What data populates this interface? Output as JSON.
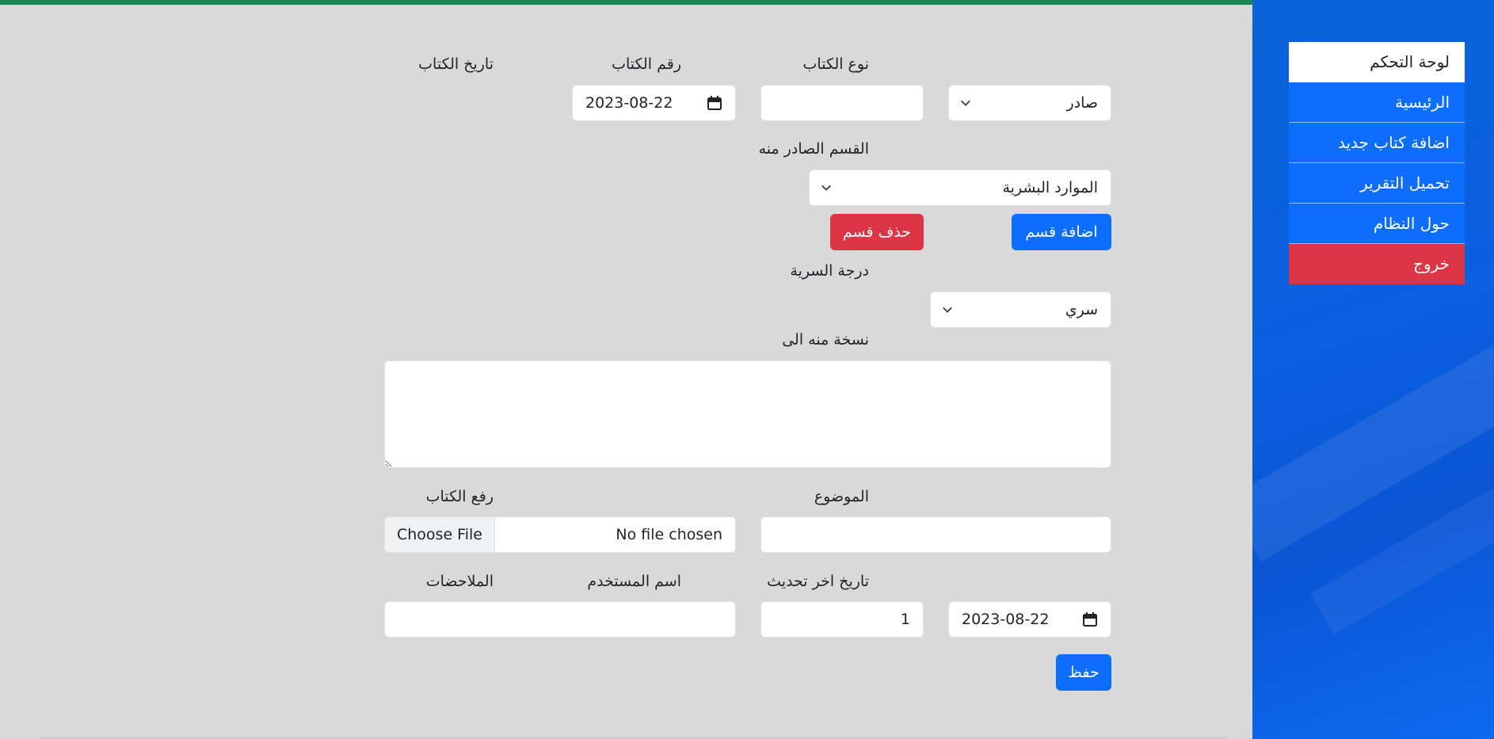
{
  "sidebar": {
    "items": [
      {
        "label": "لوحة التحكم"
      },
      {
        "label": "الرئيسية"
      },
      {
        "label": "اضافة كتاب جديد"
      },
      {
        "label": "تحميل التقرير"
      },
      {
        "label": "حول النظام"
      },
      {
        "label": "خروج"
      }
    ]
  },
  "form": {
    "book_type": {
      "label": "نوع الكتاب",
      "value": "صادر"
    },
    "book_number": {
      "label": "رقم الكتاب",
      "value": ""
    },
    "book_date": {
      "label": "تاريخ الكتاب",
      "value": "2023-08-22"
    },
    "department": {
      "label": "القسم الصادر منه",
      "value": "الموارد البشرية"
    },
    "add_department_label": "اضافة قسم",
    "delete_department_label": "حذف قسم",
    "secrecy": {
      "label": "درجة السرية",
      "value": "سري"
    },
    "copy_to": {
      "label": "نسخة منه الى",
      "value": ""
    },
    "subject": {
      "label": "الموضوع",
      "value": ""
    },
    "upload": {
      "label": "رفع الكتاب",
      "button": "Choose File",
      "status": "No file chosen"
    },
    "last_update": {
      "label": "تاريخ اخر تحديث",
      "value": "2023-08-22"
    },
    "username": {
      "label": "اسم المستخدم",
      "value": "1"
    },
    "notes": {
      "label": "الملاحضات",
      "value": ""
    },
    "save_label": "حفظ"
  },
  "colors": {
    "primary": "#0d6efd",
    "danger": "#dc3545",
    "top_strip": "#198754",
    "background": "#d9d9d9"
  }
}
